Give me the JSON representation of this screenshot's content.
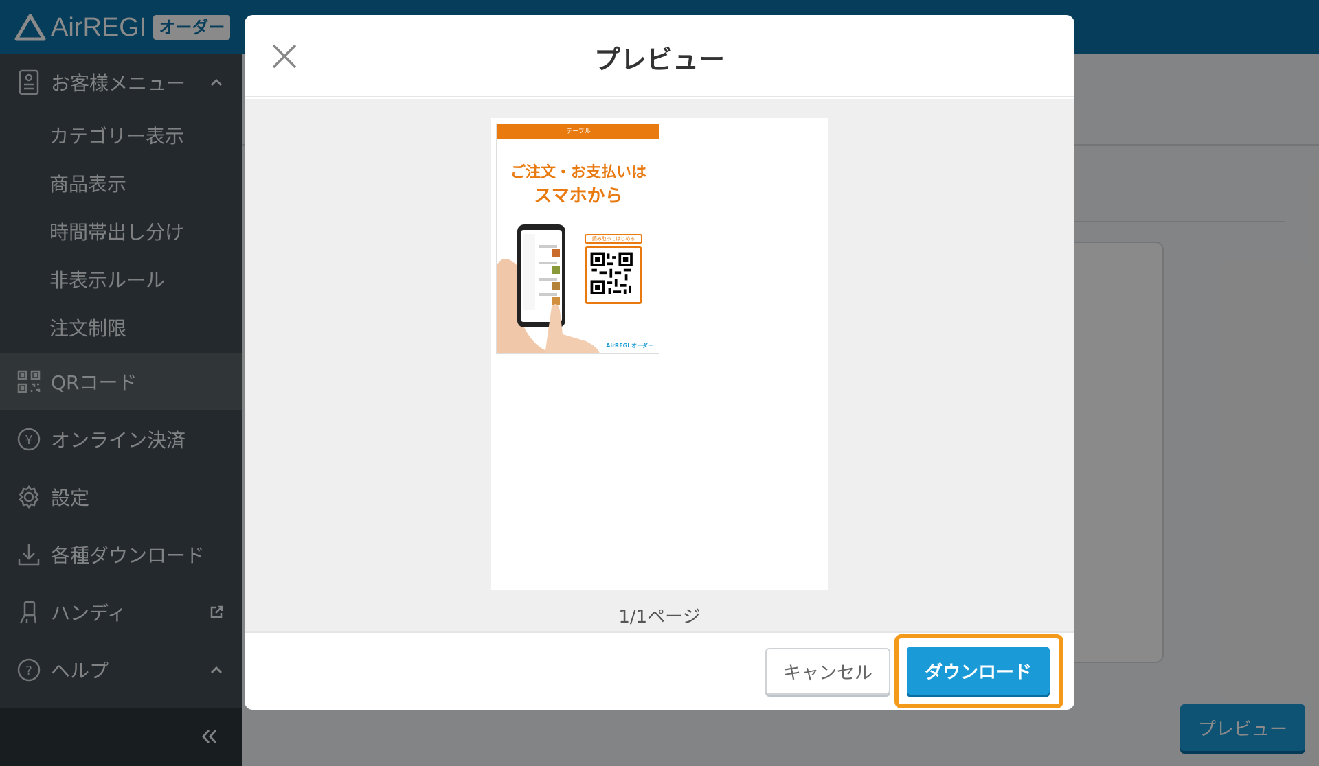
{
  "app": {
    "logo_text": "AirREGI",
    "logo_badge": "オーダー"
  },
  "sidebar": {
    "sections": [
      {
        "label": "お客様メニュー",
        "icon": "menu-book-icon",
        "expanded": true
      },
      {
        "label": "QRコード",
        "icon": "qr-code-icon",
        "active": true
      },
      {
        "label": "オンライン決済",
        "icon": "yen-circle-icon"
      },
      {
        "label": "設定",
        "icon": "gear-icon"
      },
      {
        "label": "各種ダウンロード",
        "icon": "download-icon"
      },
      {
        "label": "ハンディ",
        "icon": "handy-device-icon",
        "external": true
      },
      {
        "label": "ヘルプ",
        "icon": "help-circle-icon",
        "expanded": true
      }
    ],
    "sub_items": [
      "カテゴリー表示",
      "商品表示",
      "時間帯出し分け",
      "非表示ルール",
      "注文制限"
    ]
  },
  "background": {
    "preview_button": "プレビュー"
  },
  "modal": {
    "title": "プレビュー",
    "page_info": "1/1ページ",
    "cancel_label": "キャンセル",
    "download_label": "ダウンロード",
    "poster": {
      "top_text": "テーブル",
      "headline_1": "ご注文・お支払いは",
      "headline_2": "スマホから",
      "qr_label": "読み取ってはじめる",
      "footer_logo": "AirREGI オーダー",
      "accent": "#e87a10"
    }
  },
  "colors": {
    "topbar": "#0b72a6",
    "sidebar": "#424c53",
    "primary": "#1a9ad6",
    "highlight": "#f49a1b"
  }
}
